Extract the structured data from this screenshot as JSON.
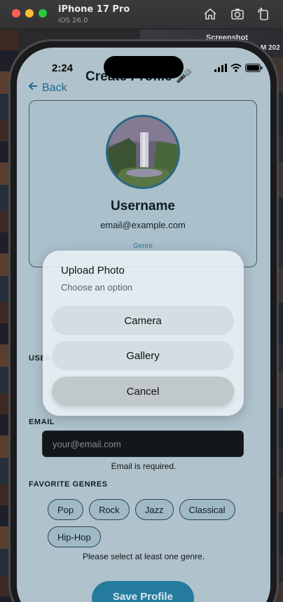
{
  "simulator": {
    "device": "iPhone 17 Pro",
    "os": "iOS 26.0",
    "icons": [
      "home-icon",
      "screenshot-icon",
      "rotate-icon"
    ]
  },
  "background": {
    "label_screenshot": "Screenshot",
    "label_right": "M 202"
  },
  "status_bar": {
    "time": "2:24"
  },
  "header": {
    "title": "Create Profile 🎤",
    "back_label": "Back"
  },
  "profile": {
    "username": "Username",
    "email": "email@example.com",
    "genre_link": "Genre"
  },
  "form": {
    "username_label": "USERNAME",
    "email_label": "EMAIL",
    "email_placeholder": "your@email.com",
    "email_error": "Email is required.",
    "genres_label": "FAVORITE GENRES",
    "genres": [
      "Pop",
      "Rock",
      "Jazz",
      "Classical",
      "Hip-Hop"
    ],
    "genres_error": "Please select at least one genre.",
    "save_label": "Save Profile"
  },
  "modal": {
    "title": "Upload Photo",
    "subtitle": "Choose an option",
    "options": [
      "Camera",
      "Gallery",
      "Cancel"
    ]
  }
}
